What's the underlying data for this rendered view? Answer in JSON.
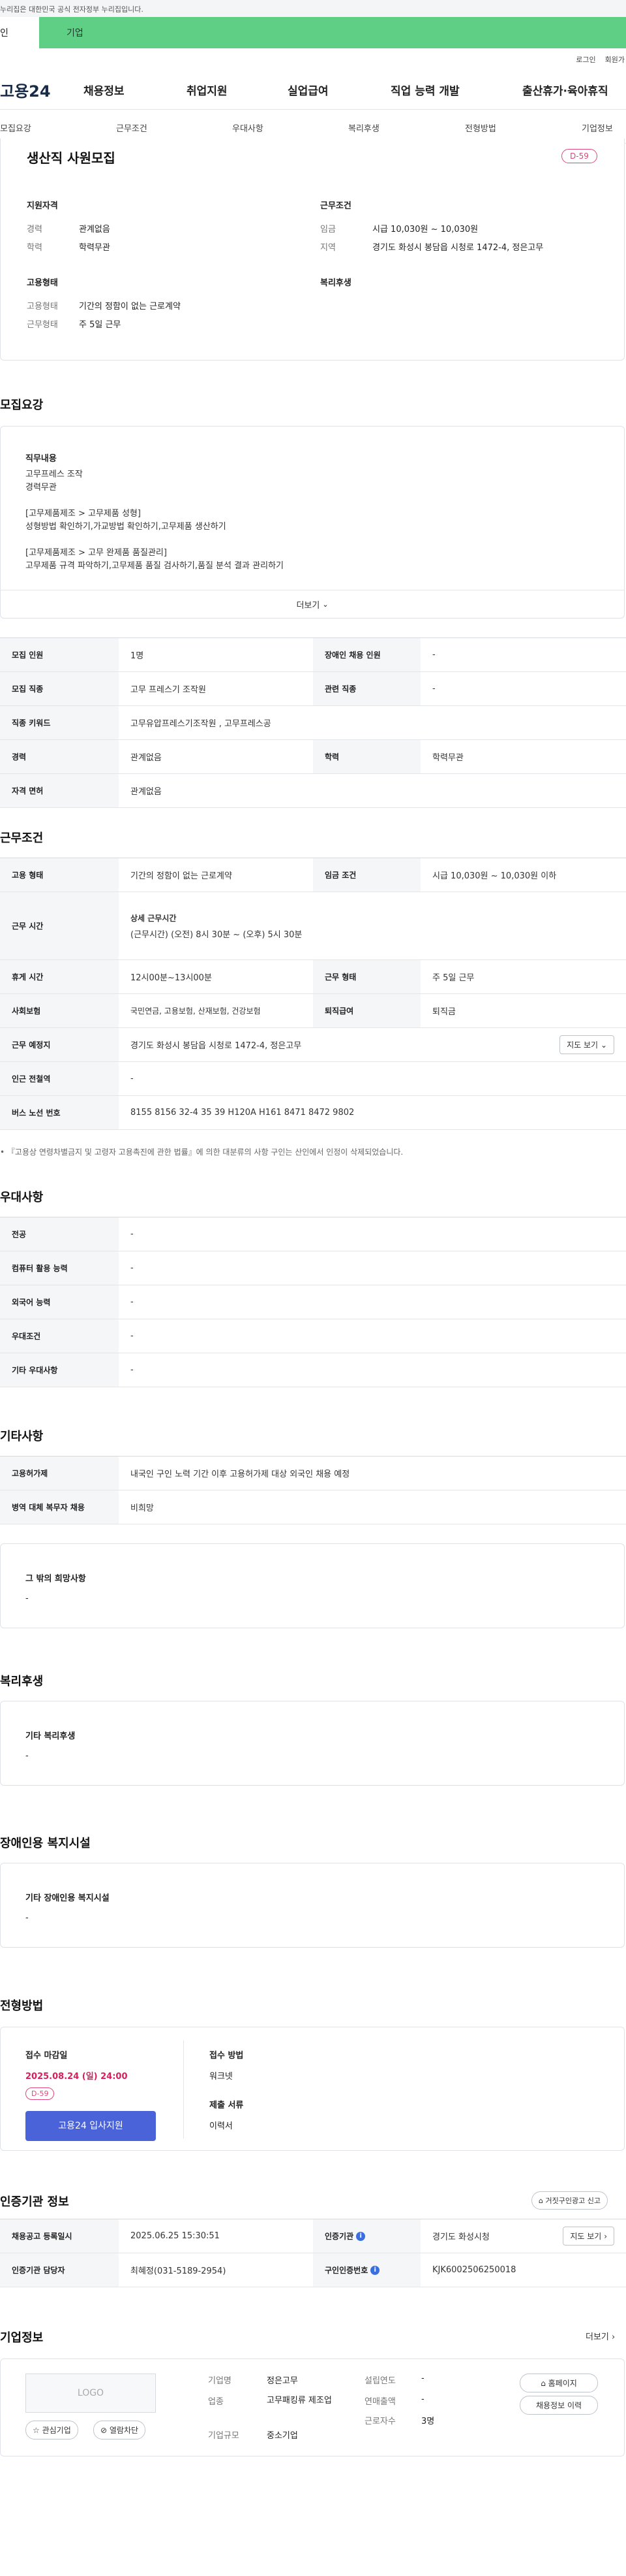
{
  "banner": {
    "text": "누리집은 대한민국 공식 전자정부 누리집입니다."
  },
  "modes": {
    "personal": "인",
    "company": "기업"
  },
  "util": {
    "login": "로그인",
    "join": "회원가"
  },
  "gnb": {
    "logo": "고용24",
    "items": [
      "채용정보",
      "취업지원",
      "실업급여",
      "직업 능력 개발",
      "출산휴가·육아휴직"
    ]
  },
  "subtabs": [
    "모집요강",
    "근무조건",
    "우대사항",
    "복리후생",
    "전형방법",
    "기업정보"
  ],
  "summary": {
    "title": "생산직 사원모집",
    "dday": "D-59",
    "qual_title": "지원자격",
    "career_label": "경력",
    "career": "관계없음",
    "edu_label": "학력",
    "edu": "학력무관",
    "work_title": "근무조건",
    "wage_label": "임금",
    "wage": "시급 10,030원 ~ 10,030원",
    "region_label": "지역",
    "region": "경기도 화성시 봉담읍 시청로 1472-4, 정은고무",
    "emp_title": "고용형태",
    "emptype_label": "고용형태",
    "emptype": "기간의 정함이 없는 근로계약",
    "worktype_label": "근무형태",
    "worktype": "주 5일 근무",
    "welfare_title": "복리후생"
  },
  "recruit": {
    "title": "모집요강",
    "job_title": "직무내용",
    "lines": [
      "고무프레스 조작",
      "경력무관",
      "",
      "[고무제품제조 > 고무제품 성형]",
      "성형방법 확인하기,가교방법 확인하기,고무제품 생산하기",
      "",
      "[고무제품제조 > 고무 완제품 품질관리]",
      "고무제품 규격 파악하기,고무제품 품질 검사하기,품질 분석 결과 관리하기"
    ],
    "more": "더보기",
    "rows": {
      "count_label": "모집 인원",
      "count": "1명",
      "disabled_label": "장애인 채용 인원",
      "disabled": "-",
      "job_label": "모집 직종",
      "job": "고무 프레스기 조작원",
      "related_label": "관련 직종",
      "related": "-",
      "kw_label": "직종 키워드",
      "kw": "고무유압프레스기조작원 , 고무프레스공",
      "career_label": "경력",
      "career": "관계없음",
      "edu_label": "학력",
      "edu": "학력무관",
      "license_label": "자격 면허",
      "license": "관계없음"
    }
  },
  "work": {
    "title": "근무조건",
    "emptype_label": "고용 형태",
    "emptype": "기간의 정함이 없는 근로계약",
    "wage_label": "임금 조건",
    "wage": "시급 10,030원 ~ 10,030원 이하",
    "hours_label": "근무 시간",
    "hours_head": "상세 근무시간",
    "hours": "(근무시간) (오전) 8시 30분 ~ (오후) 5시 30분",
    "break_label": "휴게 시간",
    "break": "12시00분~13시00분",
    "worktype_label": "근무 형태",
    "worktype": "주 5일 근무",
    "insurance_label": "사회보험",
    "insurance": "국민연금, 고용보험, 산재보험, 건강보험",
    "severance_label": "퇴직급여",
    "severance": "퇴직금",
    "place_label": "근무 예정지",
    "place": "경기도 화성시 봉담읍 시청로 1472-4, 정은고무",
    "map_btn": "지도 보기",
    "station_label": "인근 전철역",
    "station": "-",
    "bus_label": "버스 노선 번호",
    "bus": "8155 8156 32-4 35 39 H120A H161 8471 8472 9802",
    "note": "『고용상 연령차별금지 및 고령자 고용촉진에 관한 법률』에 의한 대분류의 사항 구인는 산인에서 인정이 삭제되었습니다."
  },
  "prefer": {
    "title": "우대사항",
    "rows": [
      {
        "label": "전공",
        "value": "-"
      },
      {
        "label": "컴퓨터 활용 능력",
        "value": "-"
      },
      {
        "label": "외국어 능력",
        "value": "-"
      },
      {
        "label": "우대조건",
        "value": "-"
      },
      {
        "label": "기타 우대사항",
        "value": "-"
      }
    ]
  },
  "etc": {
    "title": "기타사항",
    "rows": [
      {
        "label": "고용허가제",
        "value": "내국인 구인 노력 기간 이후 고용허가제 대상 외국인 채용 예정"
      },
      {
        "label": "병역 대체 복무자 채용",
        "value": "비희망"
      }
    ],
    "other_title": "그 밖의 희망사항",
    "other": "-"
  },
  "welfare": {
    "title": "복리후생",
    "sub": "기타 복리후생",
    "value": "-"
  },
  "disabled_fac": {
    "title": "장애인용 복지시설",
    "sub": "기타 장애인용 복지시설",
    "value": "-"
  },
  "selection": {
    "title": "전형방법",
    "deadline_label": "접수 마감일",
    "deadline": "2025.08.24 (일) 24:00",
    "dday": "D-59",
    "apply_btn": "고용24 입사지원",
    "method_label": "접수 방법",
    "method": "워크넷",
    "docs_label": "제출 서류",
    "docs": "이력서"
  },
  "agency": {
    "title": "인증기관 정보",
    "report_btn": "거짓구인광고 신고",
    "reg_label": "채용공고 등록일시",
    "reg": "2025.06.25 15:30:51",
    "org_label": "인증기관",
    "org": "경기도 화성시청",
    "dir_btn": "지도 보기",
    "mgr_label": "인증기관 담당자",
    "mgr": "최혜정(031-5189-2954)",
    "no_label": "구인인증번호",
    "no": "KJK6002506250018"
  },
  "company": {
    "title": "기업정보",
    "more": "더보기",
    "logo": "LOGO",
    "fav_btn": "관심기업",
    "block_btn": "열람차단",
    "name_label": "기업명",
    "name": "정은고무",
    "industry_label": "업종",
    "industry": "고무패킹류 제조업",
    "size_label": "기업규모",
    "size": "중소기업",
    "year_label": "설립연도",
    "year": "-",
    "sales_label": "연매출액",
    "sales": "-",
    "staff_label": "근로자수",
    "staff": "3명",
    "home_btn": "홈페이지",
    "history_btn": "채용정보 이력"
  }
}
